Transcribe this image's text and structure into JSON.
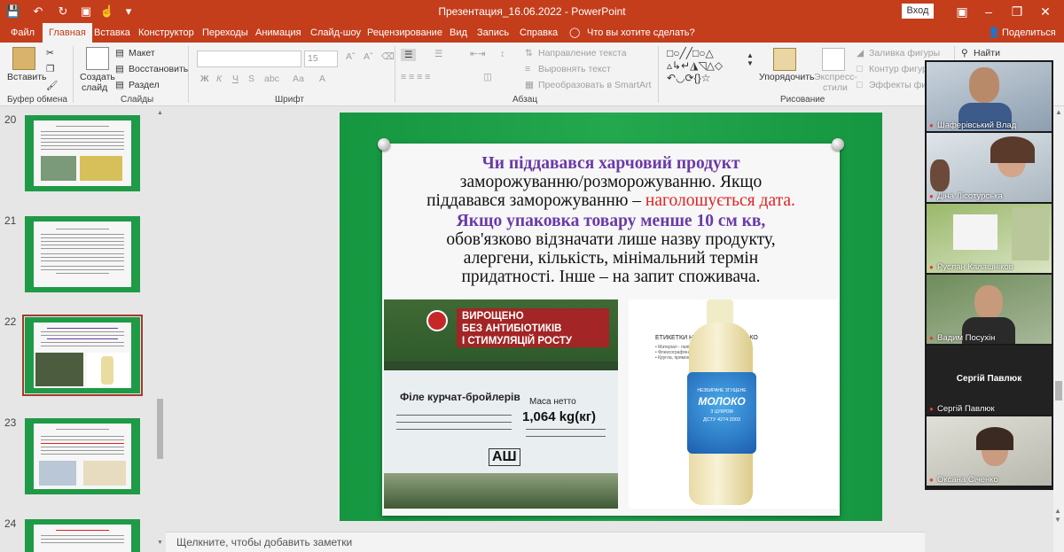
{
  "app": {
    "doc_title": "Презентация_16.06.2022  -  PowerPoint",
    "login": "Вход",
    "share": "Поделиться",
    "search": "Что вы хотите сделать?"
  },
  "tabs": [
    "Файл",
    "Главная",
    "Вставка",
    "Конструктор",
    "Переходы",
    "Анимация",
    "Слайд-шоу",
    "Рецензирование",
    "Вид",
    "Запись",
    "Справка"
  ],
  "ribbon": {
    "clipboard": {
      "paste": "Вставить",
      "label": "Буфер обмена"
    },
    "slides": {
      "new": "Создать слайд",
      "new_l1": "Создать",
      "new_l2": "слайд",
      "layout": "Макет",
      "reset": "Восстановить",
      "section": "Раздел",
      "label": "Слайды"
    },
    "font": {
      "size": "15",
      "label": "Шрифт",
      "bold": "Ж",
      "italic": "К",
      "underline": "Ч",
      "strike": "S",
      "spacing": "abc",
      "aa": "Аа"
    },
    "paragraph": {
      "direction": "Направление текста",
      "align": "Выровнять текст",
      "smartart": "Преобразовать в SmartArt",
      "label": "Абзац"
    },
    "drawing": {
      "arrange": "Упорядочить",
      "styles_l1": "Экспресс-",
      "styles_l2": "стили",
      "fill": "Заливка фигуры",
      "outline": "Контур фигуры",
      "effects": "Эффекты фигур",
      "label": "Рисование"
    },
    "editing": {
      "find": "Найти"
    }
  },
  "slides_panel": {
    "numbers": [
      "20",
      "21",
      "22",
      "23",
      "24"
    ],
    "selected": "22"
  },
  "slide": {
    "line1": "Чи піддавався харчовий продукт",
    "line2": "заморожуванню/розморожуванню. Якщо",
    "line3a": "піддавався заморожуванню – ",
    "line3b": "наголошується дата.",
    "line4": "Якщо упаковка товару менше 10 см кв,",
    "line5": "обов'язково відзначати лише назву продукту,",
    "line6": "алергени, кількість, мінімальний термін",
    "line7": "придатності. Інше – на запит споживача.",
    "photo1": {
      "banner_l1": "ВИРОЩЕНО",
      "banner_l2": "БЕЗ АНТИБІОТИКІВ",
      "banner_l3": "І СТИМУЛЯЦІЙ РОСТУ",
      "product": "Філе курчат-бройлерів",
      "mass_label": "Маса нетто",
      "mass": "1,064 kg(кг)",
      "lot": "АШ"
    },
    "photo2": {
      "header": "ЕТИКЕТКИ НА ЗГУЩЕНЕ МОЛОКО",
      "b1": "• Матеріал - папір",
      "b2": "• Флексографічний друк",
      "b3": "• Кругла, прямокутна, фігурна висічка",
      "label_top": "НЕЗБИРАНЕ ЗГУЩЕНЕ",
      "brand": "МОЛОКО",
      "sub": "З ЦУКРОМ",
      "dstu": "ДСТУ 4274:2003"
    }
  },
  "notes": "Щелкните, чтобы добавить заметки",
  "participants": [
    {
      "name": "Шаферівський Влад"
    },
    {
      "name": "Діна Лісотурська"
    },
    {
      "name": "Руслан Калашніков"
    },
    {
      "name": "Вадим Посухін"
    },
    {
      "name": "Сергій Павлюк",
      "center": "Сергій Павлюк"
    },
    {
      "name": "Оксана Січенко"
    }
  ],
  "colors": {
    "accent": "#c43e1c",
    "slide_green": "#1f9a47",
    "purple": "#6a3aa8",
    "red": "#e02222"
  }
}
